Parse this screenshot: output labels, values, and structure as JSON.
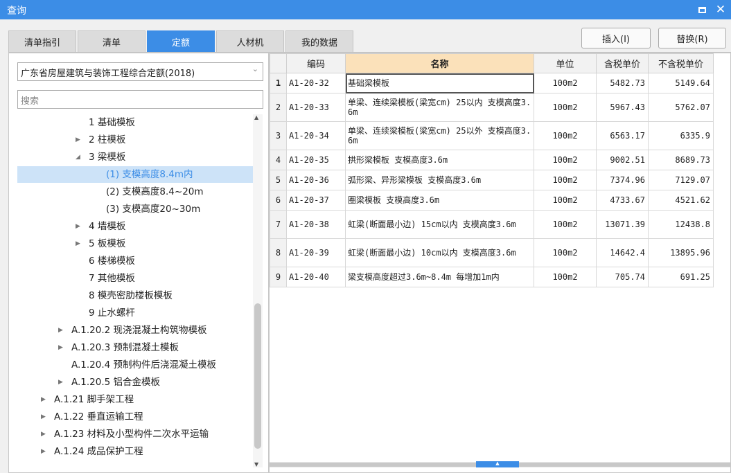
{
  "window": {
    "title": "查询"
  },
  "tabs": [
    {
      "label": "清单指引"
    },
    {
      "label": "清单"
    },
    {
      "label": "定额"
    },
    {
      "label": "人材机"
    },
    {
      "label": "我的数据"
    }
  ],
  "buttons": {
    "insert": "插入(I)",
    "replace": "替换(R)"
  },
  "left": {
    "quota_select": "广东省房屋建筑与装饰工程综合定额(2018)",
    "search_placeholder": "搜索",
    "tree": [
      {
        "label": "1 基础模板",
        "caret": ""
      },
      {
        "label": "2 柱模板",
        "caret": "▶"
      },
      {
        "label": "3 梁模板",
        "caret": "◢"
      },
      {
        "label": "(1) 支模高度8.4m内",
        "caret": "",
        "selected": true
      },
      {
        "label": "(2) 支模高度8.4~20m",
        "caret": ""
      },
      {
        "label": "(3) 支模高度20~30m",
        "caret": ""
      },
      {
        "label": "4 墙模板",
        "caret": "▶"
      },
      {
        "label": "5 板模板",
        "caret": "▶"
      },
      {
        "label": "6 楼梯模板",
        "caret": ""
      },
      {
        "label": "7 其他模板",
        "caret": ""
      },
      {
        "label": "8 模壳密肋楼板模板",
        "caret": ""
      },
      {
        "label": "9 止水螺杆",
        "caret": ""
      },
      {
        "label": "A.1.20.2 现浇混凝土构筑物模板",
        "caret": "▶"
      },
      {
        "label": "A.1.20.3 预制混凝土模板",
        "caret": "▶"
      },
      {
        "label": "A.1.20.4 预制构件后浇混凝土模板",
        "caret": ""
      },
      {
        "label": "A.1.20.5 铝合金模板",
        "caret": "▶"
      },
      {
        "label": "A.1.21 脚手架工程",
        "caret": "▶"
      },
      {
        "label": "A.1.22 垂直运输工程",
        "caret": "▶"
      },
      {
        "label": "A.1.23 材料及小型构件二次水平运输",
        "caret": "▶"
      },
      {
        "label": "A.1.24 成品保护工程",
        "caret": "▶"
      }
    ]
  },
  "grid": {
    "columns": [
      "编码",
      "名称",
      "单位",
      "含税单价",
      "不含税单价"
    ],
    "rows": [
      {
        "no": "1",
        "code": "A1-20-32",
        "name": "基础梁模板",
        "unit": "100m2",
        "tax_price": "5482.73",
        "notax_price": "5149.64"
      },
      {
        "no": "2",
        "code": "A1-20-33",
        "name": "单梁、连续梁模板(梁宽cm) 25以内 支模高度3.6m",
        "unit": "100m2",
        "tax_price": "5967.43",
        "notax_price": "5762.07"
      },
      {
        "no": "3",
        "code": "A1-20-34",
        "name": "单梁、连续梁模板(梁宽cm) 25以外 支模高度3.6m",
        "unit": "100m2",
        "tax_price": "6563.17",
        "notax_price": "6335.9"
      },
      {
        "no": "4",
        "code": "A1-20-35",
        "name": "拱形梁模板 支模高度3.6m",
        "unit": "100m2",
        "tax_price": "9002.51",
        "notax_price": "8689.73"
      },
      {
        "no": "5",
        "code": "A1-20-36",
        "name": "弧形梁、异形梁模板 支模高度3.6m",
        "unit": "100m2",
        "tax_price": "7374.96",
        "notax_price": "7129.07"
      },
      {
        "no": "6",
        "code": "A1-20-37",
        "name": "圈梁模板 支模高度3.6m",
        "unit": "100m2",
        "tax_price": "4733.67",
        "notax_price": "4521.62"
      },
      {
        "no": "7",
        "code": "A1-20-38",
        "name": "虹梁(断面最小边) 15cm以内 支模高度3.6m",
        "unit": "100m2",
        "tax_price": "13071.39",
        "notax_price": "12438.8"
      },
      {
        "no": "8",
        "code": "A1-20-39",
        "name": "虹梁(断面最小边) 10cm以内 支模高度3.6m",
        "unit": "100m2",
        "tax_price": "14642.4",
        "notax_price": "13895.96"
      },
      {
        "no": "9",
        "code": "A1-20-40",
        "name": "梁支模高度超过3.6m~8.4m 每增加1m内",
        "unit": "100m2",
        "tax_price": "705.74",
        "notax_price": "691.25"
      }
    ]
  },
  "colors": {
    "accent": "#3c8de6",
    "selected_bg": "#cde3f8",
    "name_header_bg": "#fbe1ba"
  }
}
